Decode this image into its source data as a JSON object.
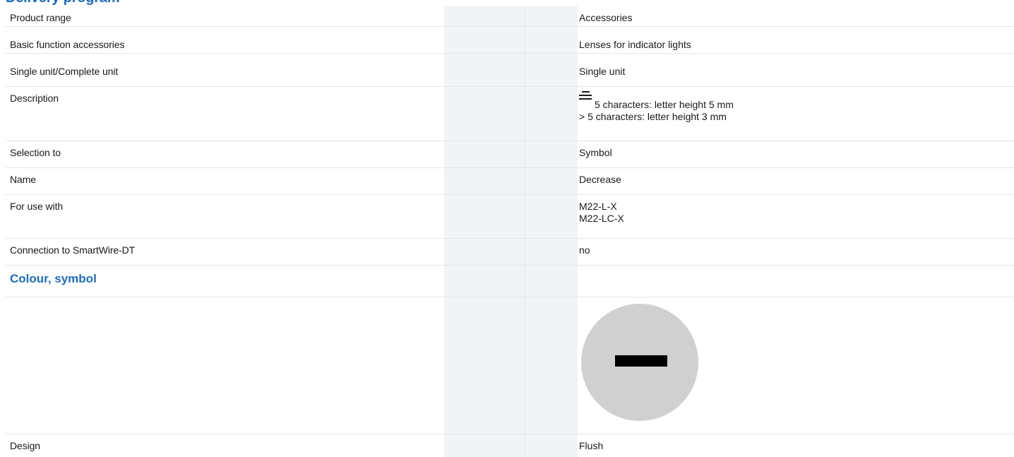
{
  "page": {
    "partial_heading": "Delivery program"
  },
  "rows": [
    {
      "label": "Product range",
      "value": "Accessories"
    },
    {
      "label": "Basic function accessories",
      "value": "Lenses for indicator lights"
    },
    {
      "label": "Single unit/Complete unit",
      "value": "Single unit"
    },
    {
      "label": "Description",
      "value_lines": [
        "5 characters: letter height 5 mm",
        "> 5 characters: letter height 3 mm"
      ],
      "icon": "text-lines-icon"
    },
    {
      "label": "Selection to",
      "value": "Symbol"
    },
    {
      "label": "Name",
      "value": "Decrease"
    },
    {
      "label": "For use with",
      "value_lines": [
        "M22-L-X",
        "M22-LC-X"
      ]
    },
    {
      "label": "Connection to SmartWire-DT",
      "value": "no"
    }
  ],
  "section": {
    "title": "Colour, symbol"
  },
  "lens": {
    "icon": "minus-symbol-lens-icon",
    "color": "#d0d0d0",
    "symbol_color": "#000000"
  },
  "last_row": {
    "label": "Design",
    "value": "Flush"
  },
  "colors": {
    "accent": "#1c6dbd",
    "column_shade": "#f2f3f5"
  }
}
